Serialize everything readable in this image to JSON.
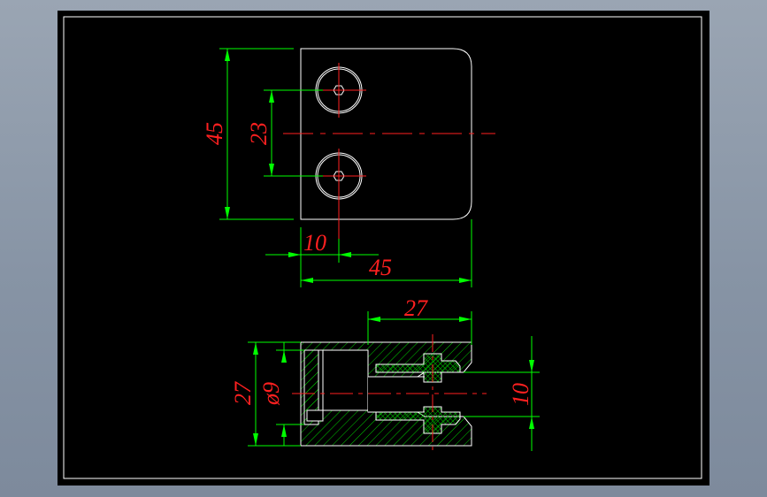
{
  "colors": {
    "background": "#8794a5",
    "sheet": "#000000",
    "outline": "#ffffff",
    "dimension": "#00ff00",
    "dimension_text": "#ff2020",
    "center_line": "#ff2020",
    "hatch_body": "#00cc00",
    "hatch_pad": "#00cc00",
    "border": "#ffffff"
  },
  "top_view": {
    "overall_height": "45",
    "hole_spacing": "23",
    "hole_offset": "10",
    "overall_width": "45"
  },
  "section_view": {
    "depth": "27",
    "overall_height": "27",
    "bore_diameter": "ø9",
    "slot_gap": "10"
  }
}
